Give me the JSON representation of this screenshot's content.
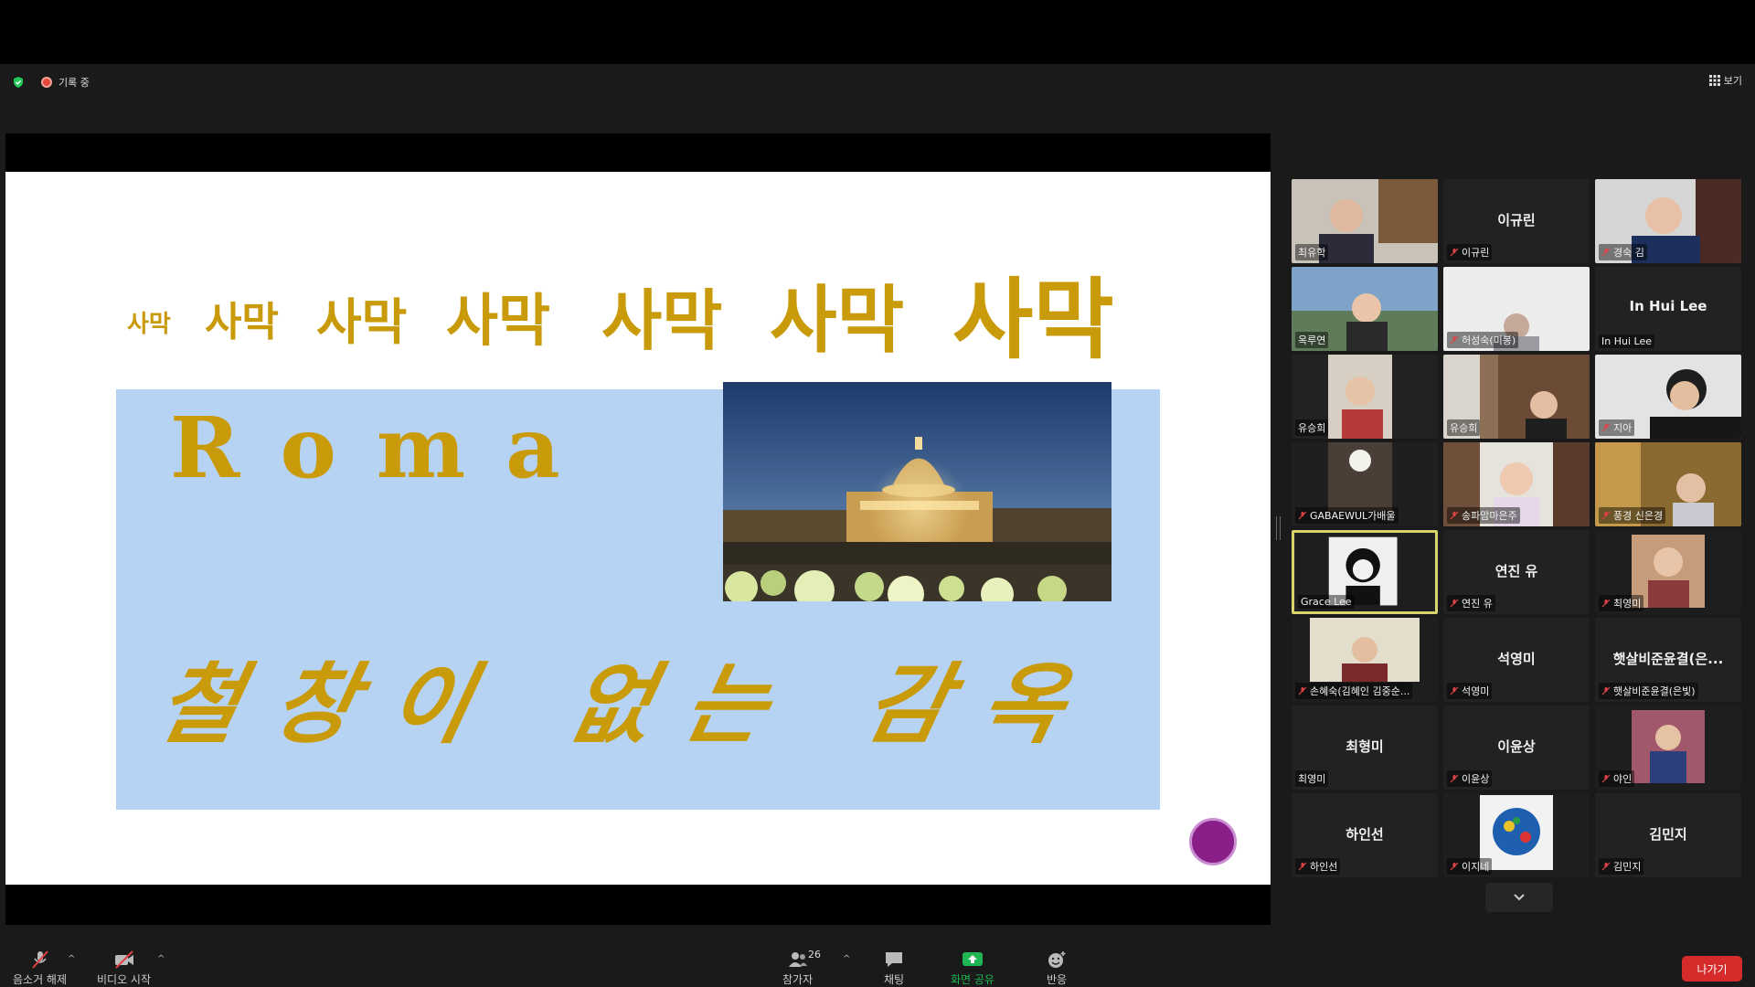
{
  "status": {
    "recording_label": "기록 중",
    "view_label": "보기"
  },
  "slide": {
    "desert_words": [
      "사막",
      "사막",
      "사막",
      "사막",
      "사막",
      "사막",
      "사막"
    ],
    "roma": "Roma",
    "prison_text": "철창이 없는 감옥"
  },
  "participants": [
    {
      "name": "최유학",
      "display": "",
      "video": true
    },
    {
      "name": "이규린",
      "display": "이규린",
      "video": false
    },
    {
      "name": "경숙 김",
      "display": "",
      "video": true
    },
    {
      "name": "옥루연",
      "display": "",
      "video": true
    },
    {
      "name": "허성숙(미봉)",
      "display": "",
      "video": true
    },
    {
      "name": "In Hui Lee",
      "display": "In Hui Lee",
      "video": false
    },
    {
      "name": "유승희",
      "display": "",
      "video": true
    },
    {
      "name": "유승희",
      "display": "",
      "video": true
    },
    {
      "name": "지아",
      "display": "",
      "video": true
    },
    {
      "name": "GABAEWUL가배울",
      "display": "",
      "video": true
    },
    {
      "name": "송파맘마은주",
      "display": "",
      "video": true
    },
    {
      "name": "풍경 신은경",
      "display": "",
      "video": true
    },
    {
      "name": "Grace Lee",
      "display": "",
      "video": true
    },
    {
      "name": "연진 유",
      "display": "연진 유",
      "video": false
    },
    {
      "name": "최영미",
      "display": "",
      "video": true
    },
    {
      "name": "손혜숙(김혜인 김중순...",
      "display": "",
      "video": true
    },
    {
      "name": "석영미",
      "display": "석영미",
      "video": false
    },
    {
      "name": "햇살비준윤결(은빛)",
      "display": "햇살비준윤결(은...",
      "video": false
    },
    {
      "name": "최영미",
      "display": "최형미",
      "video": false
    },
    {
      "name": "이윤상",
      "display": "이윤상",
      "video": false
    },
    {
      "name": "야인",
      "display": "",
      "video": true
    },
    {
      "name": "하인선",
      "display": "하인선",
      "video": false
    },
    {
      "name": "이지네",
      "display": "",
      "video": true
    },
    {
      "name": "김민지",
      "display": "김민지",
      "video": false
    }
  ],
  "toolbar": {
    "audio": "음소거 해제",
    "video": "비디오 시작",
    "participants": "참가자",
    "participants_count": "26",
    "chat": "채팅",
    "share": "화면 공유",
    "reactions": "반응",
    "leave": "나가기"
  },
  "colors": {
    "accent_gold": "#c99a0a",
    "slide_blue": "#b7d3f3",
    "leave_red": "#d52b2b",
    "share_green": "#1fb653"
  }
}
